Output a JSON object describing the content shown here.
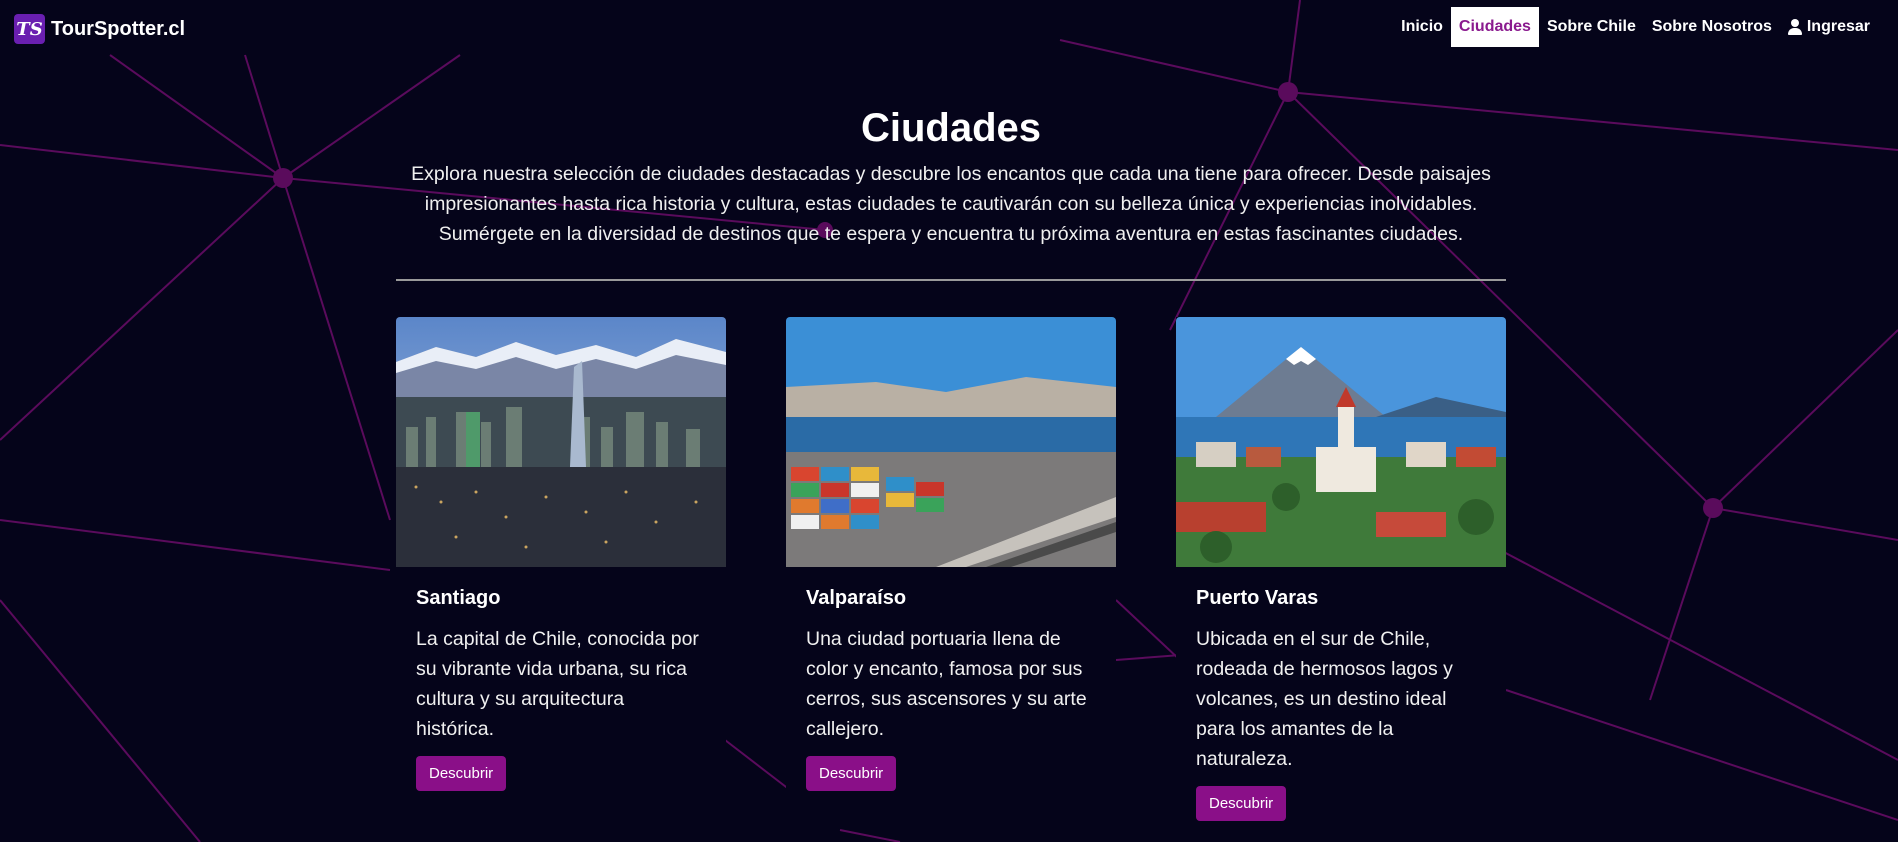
{
  "navbar": {
    "logo_text": "TS",
    "brand": "TourSpotter.cl",
    "links": [
      "Inicio",
      "Ciudades",
      "Sobre Chile",
      "Sobre Nosotros"
    ],
    "active": "Ciudades",
    "login_label": "Ingresar"
  },
  "main": {
    "title": "Ciudades",
    "intro": "Explora nuestra selección de ciudades destacadas y descubre los encantos que cada una tiene para ofrecer. Desde paisajes impresionantes hasta rica historia y cultura, estas ciudades te cautivarán con su belleza única y experiencias inolvidables. Sumérgete en la diversidad de destinos que te espera y encuentra tu próxima aventura en estas fascinantes ciudades."
  },
  "cards": [
    {
      "title": "Santiago",
      "text": "La capital de Chile, conocida por su vibrante vida urbana, su rica cultura y su arquitectura histórica.",
      "button": "Descubrir"
    },
    {
      "title": "Valparaíso",
      "text": "Una ciudad portuaria llena de color y encanto, famosa por sus cerros, sus ascensores y su arte callejero.",
      "button": "Descubrir"
    },
    {
      "title": "Puerto Varas",
      "text": "Ubicada en el sur de Chile, rodeada de hermosos lagos y volcanes, es un destino ideal para los amantes de la naturaleza.",
      "button": "Descubrir"
    }
  ],
  "colors": {
    "background": "#05041a",
    "accent": "#8a0f88",
    "network_lines": "#5e0c5e",
    "logo_bg": "#6a1fb0"
  }
}
